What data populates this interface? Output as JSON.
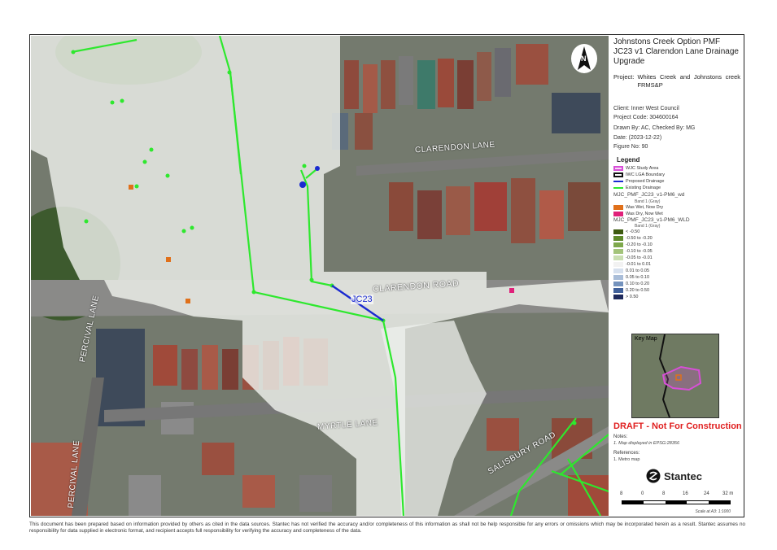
{
  "map": {
    "street_labels": {
      "clarendon_lane": "CLARENDON LANE",
      "clarendon_road": "CLARENDON ROAD",
      "myrtle_lane": "MYRTLE LANE",
      "percival_lane_1": "PERCIVAL LANE",
      "percival_lane_2": "PERCIVAL LANE",
      "salisbury_road": "SALISBURY ROAD"
    },
    "pipe_label": "JC23",
    "north_arrow": "N"
  },
  "title_block": {
    "title_line1": "Johnstons Creek Option PMF",
    "title_line2": "JC23 v1 Clarendon Lane Drainage",
    "title_line3": "Upgrade",
    "project_label": "Project:",
    "project_value": "Whites Creek and Johnstons creek FRMS&P",
    "client": "Client:  Inner West Council",
    "project_code": "Project Code:  304600164",
    "drawn_by": "Drawn By:  AC, Checked By: MG",
    "date": "Date:  (2023-12-22)",
    "figure_no": "Figure No:  90"
  },
  "legend": {
    "title": "Legend",
    "items": [
      {
        "label": "WJC Study Area",
        "style": "outline",
        "color": "#d84fd8"
      },
      {
        "label": "IWC LGA Boundary",
        "style": "outline",
        "color": "#111111"
      },
      {
        "label": "Proposed Drainage",
        "style": "line",
        "color": "#1a2ad0"
      },
      {
        "label": "Existing Drainage",
        "style": "line",
        "color": "#2ee82e"
      }
    ],
    "wd_group": {
      "title": "MJC_PMF_JC23_v1-PM6_wd",
      "band": "Band 1 (Gray)",
      "items": [
        {
          "label": "Was Wet, Now Dry",
          "color": "#e0701a"
        },
        {
          "label": "Was Dry, Now Wet",
          "color": "#e0207a"
        }
      ]
    },
    "wld_group": {
      "title": "MJC_PMF_JC23_v1-PM6_WLD",
      "band": "Band 1 (Gray)",
      "items": [
        {
          "label": "< -0.50",
          "color": "#3d5a10"
        },
        {
          "label": "-0.50 to -0.20",
          "color": "#5e8a2a"
        },
        {
          "label": "-0.20 to -0.10",
          "color": "#7ea84c"
        },
        {
          "label": "-0.10 to -0.05",
          "color": "#a3c47a"
        },
        {
          "label": "-0.05 to -0.01",
          "color": "#cadfb2"
        },
        {
          "label": "-0.01 to 0.01",
          "color": "#f2f2f2"
        },
        {
          "label": "0.01 to 0.05",
          "color": "#d6e0ee"
        },
        {
          "label": "0.05 to 0.10",
          "color": "#a9bdd8"
        },
        {
          "label": "0.10 to 0.20",
          "color": "#7593bd"
        },
        {
          "label": "0.20 to 0.50",
          "color": "#40609a"
        },
        {
          "label": "> 0.50",
          "color": "#1e2a5c"
        }
      ]
    }
  },
  "key_map_label": "Key Map",
  "draft": "DRAFT - Not For Construction",
  "notes": {
    "heading": "Notes:",
    "item1": "1. Map displayed in EPSG:28356"
  },
  "references": {
    "heading": "References:",
    "item1": "1. Metro map"
  },
  "logo_name": "Stantec",
  "scale": {
    "labels": [
      "8",
      "0",
      "8",
      "16",
      "24",
      "32 m"
    ],
    "note": "Scale at A3: 1:1000"
  },
  "disclaimer": "This document has been prepared based on information provided by others as cited in the data sources. Stantec has not verified the accuracy and/or completeness of this information as shall not be help responsible for any errors or omissions which may be incorporated herein as a result. Stantec assumes no responsibility for data supplied in electronic format, and recipient accepts full responsibility for verifying the accuracy and completeness of the data."
}
